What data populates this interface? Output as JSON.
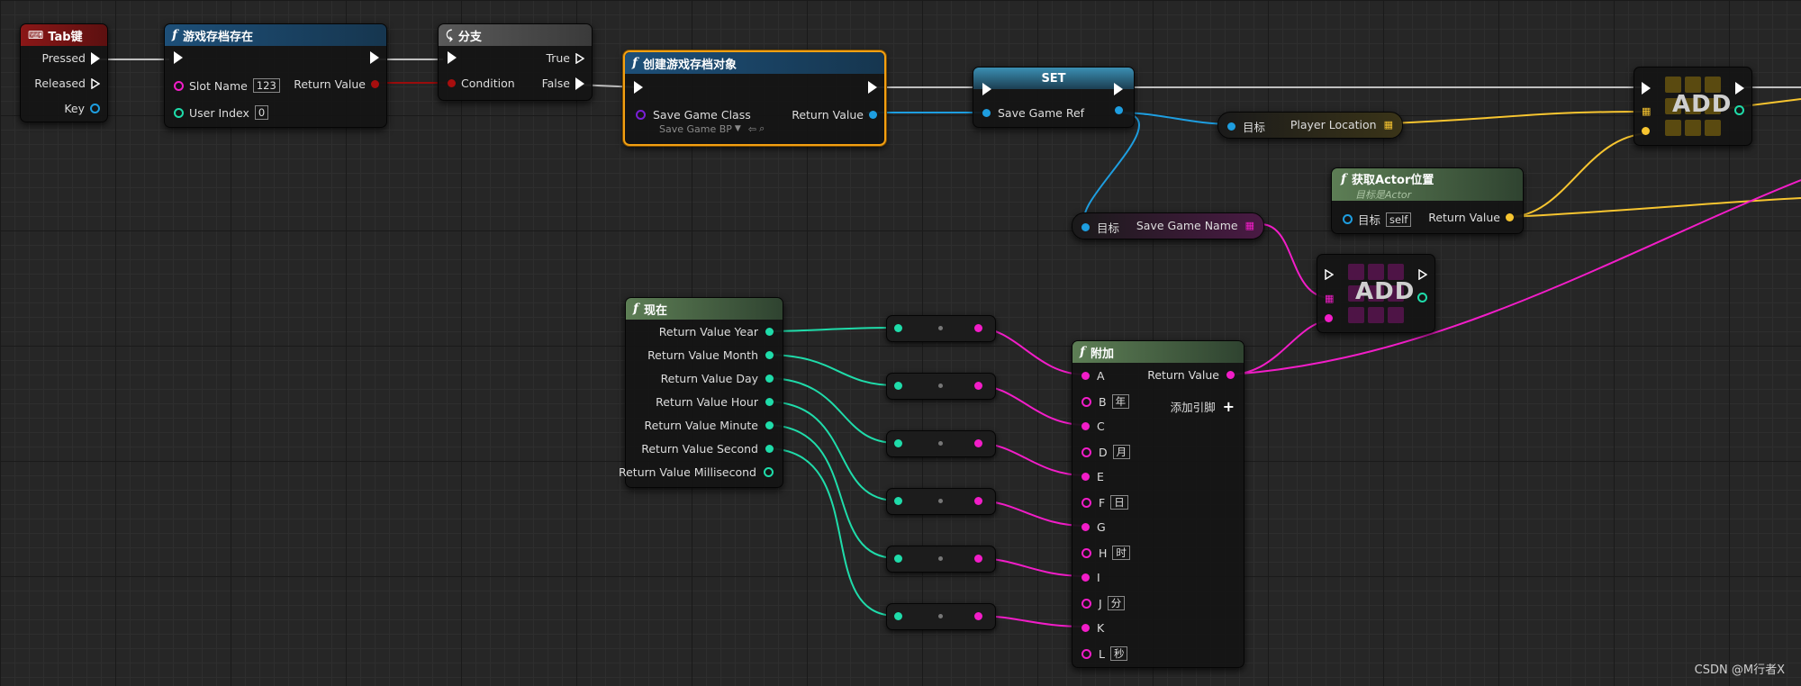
{
  "nodes": {
    "tab_key": {
      "title": "Tab键",
      "pressed": "Pressed",
      "released": "Released",
      "key": "Key"
    },
    "does_save_exist": {
      "title": "游戏存档存在",
      "slot_name": "Slot Name",
      "slot_value": "123",
      "user_index": "User Index",
      "user_index_value": "0",
      "return_value": "Return Value"
    },
    "branch": {
      "title": "分支",
      "true_label": "True",
      "condition": "Condition",
      "false_label": "False"
    },
    "create_save": {
      "title": "创建游戏存档对象",
      "save_game_class": "Save Game Class",
      "class_value": "Save Game BP",
      "return_value": "Return Value"
    },
    "set_node": {
      "title": "SET",
      "save_game_ref": "Save Game Ref"
    },
    "player_location": {
      "target": "目标",
      "label": "Player Location"
    },
    "get_actor_location": {
      "title": "获取Actor位置",
      "subtitle": "目标是Actor",
      "target": "目标",
      "target_value": "self",
      "return_value": "Return Value"
    },
    "save_game_name": {
      "target": "目标",
      "label": "Save Game Name"
    },
    "add_top": {
      "label": "ADD"
    },
    "add_mid": {
      "label": "ADD"
    },
    "now": {
      "title": "现在",
      "outputs": [
        "Return Value Year",
        "Return Value Month",
        "Return Value Day",
        "Return Value Hour",
        "Return Value Minute",
        "Return Value Second",
        "Return Value Millisecond"
      ]
    },
    "append": {
      "title": "附加",
      "return_value": "Return Value",
      "add_pin": "添加引脚",
      "pins": [
        {
          "name": "A",
          "value": ""
        },
        {
          "name": "B",
          "value": "年"
        },
        {
          "name": "C",
          "value": ""
        },
        {
          "name": "D",
          "value": "月"
        },
        {
          "name": "E",
          "value": ""
        },
        {
          "name": "F",
          "value": "日"
        },
        {
          "name": "G",
          "value": ""
        },
        {
          "name": "H",
          "value": "时"
        },
        {
          "name": "I",
          "value": ""
        },
        {
          "name": "J",
          "value": "分"
        },
        {
          "name": "K",
          "value": ""
        },
        {
          "name": "L",
          "value": "秒"
        }
      ]
    }
  },
  "watermark": "CSDN @M行者X",
  "colors": {
    "exec": "#ffffff",
    "string": "#f21dc8",
    "object": "#1e9ee0",
    "bool": "#a80e0e",
    "int": "#1fdcaa",
    "vector": "#f7c530",
    "class": "#7a1fd6",
    "selection": "#f4a012"
  }
}
